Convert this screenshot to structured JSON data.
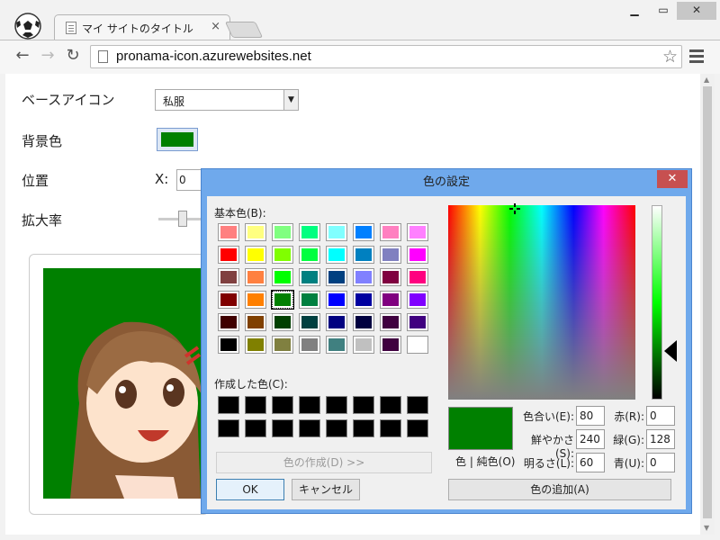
{
  "browser": {
    "tab_title": "マイ サイトのタイトル",
    "tab_close": "×",
    "url": "pronama-icon.azurewebsites.net",
    "window_min": "▁",
    "window_max": "▭",
    "window_close": "✕",
    "back": "←",
    "forward": "→",
    "reload": "↻",
    "star": "☆"
  },
  "form": {
    "base_icon_label": "ベースアイコン",
    "base_icon_value": "私服",
    "bg_color_label": "背景色",
    "bg_color": "#008000",
    "position_label": "位置",
    "x_label": "X:",
    "x_value": "0",
    "scale_label": "拡大率"
  },
  "dialog": {
    "title": "色の設定",
    "close": "✕",
    "basic_colors_label": "基本色(B):",
    "custom_colors_label": "作成した色(C):",
    "define_button": "色の作成(D) >>",
    "ok_button": "OK",
    "cancel_button": "キャンセル",
    "add_button": "色の追加(A)",
    "color_solid_label": "色 | 純色(O)",
    "hue_label": "色合い(E):",
    "hue": "80",
    "sat_label": "鮮やかさ(S):",
    "sat": "240",
    "lum_label": "明るさ(L):",
    "lum": "60",
    "red_label": "赤(R):",
    "red": "0",
    "green_label": "緑(G):",
    "green": "128",
    "blue_label": "青(U):",
    "blue": "0",
    "current_color": "#008000",
    "basic_colors": [
      "#ff8080",
      "#ffff80",
      "#80ff80",
      "#00ff80",
      "#80ffff",
      "#0080ff",
      "#ff80c0",
      "#ff80ff",
      "#ff0000",
      "#ffff00",
      "#80ff00",
      "#00ff40",
      "#00ffff",
      "#0080c0",
      "#8080c0",
      "#ff00ff",
      "#804040",
      "#ff8040",
      "#00ff00",
      "#008080",
      "#004080",
      "#8080ff",
      "#800040",
      "#ff0080",
      "#800000",
      "#ff8000",
      "#008000",
      "#008040",
      "#0000ff",
      "#0000a0",
      "#800080",
      "#8000ff",
      "#400000",
      "#804000",
      "#004000",
      "#004040",
      "#000080",
      "#000040",
      "#400040",
      "#400080",
      "#000000",
      "#808000",
      "#808040",
      "#808080",
      "#408080",
      "#c0c0c0",
      "#400040",
      "#ffffff"
    ],
    "selected_index": 26
  }
}
